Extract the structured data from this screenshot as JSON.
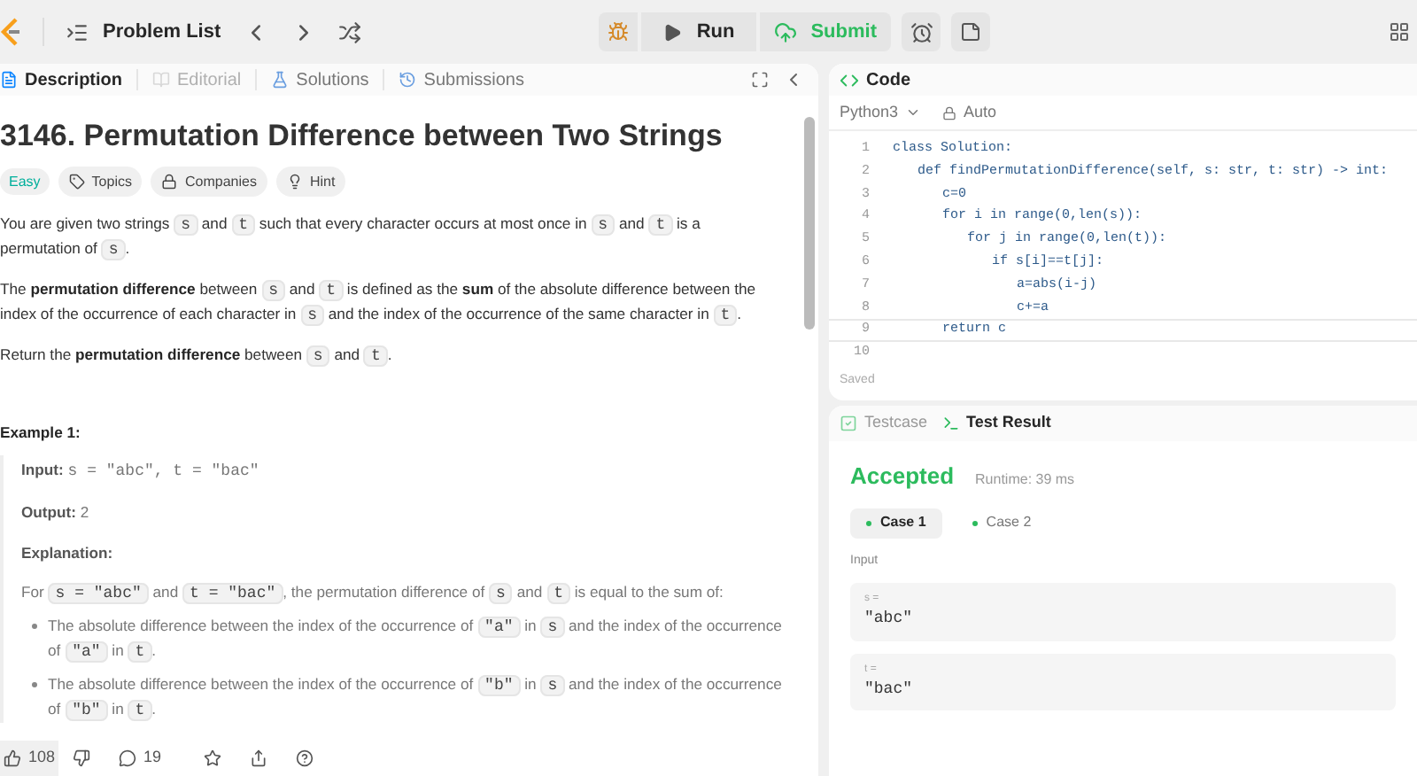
{
  "topbar": {
    "title": "Problem List",
    "run": "Run",
    "submit": "Submit"
  },
  "left_tabs": [
    {
      "label": "Description",
      "selected": true,
      "disabled": false,
      "kind": "description"
    },
    {
      "label": "Editorial",
      "selected": false,
      "disabled": true,
      "kind": "editorial"
    },
    {
      "label": "Solutions",
      "selected": false,
      "disabled": false,
      "kind": "solutions"
    },
    {
      "label": "Submissions",
      "selected": false,
      "disabled": false,
      "kind": "submissions"
    }
  ],
  "problem": {
    "title": "3146. Permutation Difference between Two Strings",
    "difficulty": "Easy",
    "tags": [
      {
        "label": "Topics",
        "kind": "tag"
      },
      {
        "label": "Companies",
        "kind": "lock"
      },
      {
        "label": "Hint",
        "kind": "bulb"
      }
    ],
    "paragraphs": [
      [
        {
          "kind": "text",
          "text": "You are given two strings "
        },
        {
          "kind": "code",
          "text": "s"
        },
        {
          "kind": "text",
          "text": " and "
        },
        {
          "kind": "code",
          "text": "t"
        },
        {
          "kind": "text",
          "text": " such that every character occurs at most once in "
        },
        {
          "kind": "code",
          "text": "s"
        },
        {
          "kind": "text",
          "text": " and "
        },
        {
          "kind": "code",
          "text": "t"
        },
        {
          "kind": "text",
          "text": " is a permutation of "
        },
        {
          "kind": "code",
          "text": "s"
        },
        {
          "kind": "text",
          "text": "."
        }
      ],
      [
        {
          "kind": "text",
          "text": "The "
        },
        {
          "kind": "bold",
          "text": "permutation difference"
        },
        {
          "kind": "text",
          "text": " between "
        },
        {
          "kind": "code",
          "text": "s"
        },
        {
          "kind": "text",
          "text": " and "
        },
        {
          "kind": "code",
          "text": "t"
        },
        {
          "kind": "text",
          "text": " is defined as the "
        },
        {
          "kind": "bold",
          "text": "sum"
        },
        {
          "kind": "text",
          "text": " of the absolute difference between the index of the occurrence of each character in "
        },
        {
          "kind": "code",
          "text": "s"
        },
        {
          "kind": "text",
          "text": " and the index of the occurrence of the same character in "
        },
        {
          "kind": "code",
          "text": "t"
        },
        {
          "kind": "text",
          "text": "."
        }
      ],
      [
        {
          "kind": "text",
          "text": "Return the "
        },
        {
          "kind": "bold",
          "text": "permutation difference"
        },
        {
          "kind": "text",
          "text": " between "
        },
        {
          "kind": "code",
          "text": "s"
        },
        {
          "kind": "text",
          "text": " and "
        },
        {
          "kind": "code",
          "text": "t"
        },
        {
          "kind": "text",
          "text": "."
        }
      ]
    ],
    "example": {
      "heading": "Example 1:",
      "input_label": "Input:",
      "input": "s = \"abc\", t = \"bac\"",
      "output_label": "Output:",
      "output": "2",
      "explanation_label": "Explanation:",
      "explanation": [
        {
          "kind": "text",
          "text": "For "
        },
        {
          "kind": "code",
          "text": "s = \"abc\""
        },
        {
          "kind": "text",
          "text": " and "
        },
        {
          "kind": "code",
          "text": "t = \"bac\""
        },
        {
          "kind": "text",
          "text": ", the permutation difference of "
        },
        {
          "kind": "code",
          "text": "s"
        },
        {
          "kind": "text",
          "text": " and "
        },
        {
          "kind": "code",
          "text": "t"
        },
        {
          "kind": "text",
          "text": " is equal to the sum of:"
        }
      ],
      "bullets": [
        [
          {
            "kind": "text",
            "text": "The absolute difference between the index of the occurrence of "
          },
          {
            "kind": "code",
            "text": "\"a\""
          },
          {
            "kind": "text",
            "text": " in "
          },
          {
            "kind": "code",
            "text": "s"
          },
          {
            "kind": "text",
            "text": " and the index of the occurrence of "
          },
          {
            "kind": "code",
            "text": "\"a\""
          },
          {
            "kind": "text",
            "text": " in "
          },
          {
            "kind": "code",
            "text": "t"
          },
          {
            "kind": "text",
            "text": "."
          }
        ],
        [
          {
            "kind": "text",
            "text": "The absolute difference between the index of the occurrence of "
          },
          {
            "kind": "code",
            "text": "\"b\""
          },
          {
            "kind": "text",
            "text": " in "
          },
          {
            "kind": "code",
            "text": "s"
          },
          {
            "kind": "text",
            "text": " and the index of the occurrence of "
          },
          {
            "kind": "code",
            "text": "\"b\""
          },
          {
            "kind": "text",
            "text": " in "
          },
          {
            "kind": "code",
            "text": "t"
          },
          {
            "kind": "text",
            "text": "."
          }
        ]
      ]
    }
  },
  "footer": {
    "likes": "108",
    "comments": "19"
  },
  "code_panel": {
    "title": "Code",
    "language": "Python3",
    "mode": "Auto",
    "status": "Saved",
    "lines": [
      {
        "number": "1",
        "text": "class Solution:",
        "children": [
          {
            "number": "2",
            "text": "def findPermutationDifference(self, s: str, t: str) -> int:",
            "children": [
              {
                "number": "3",
                "text": "c=0"
              },
              {
                "number": "4",
                "text": "for i in range(0,len(s)):",
                "children": [
                  {
                    "number": "5",
                    "text": "for j in range(0,len(t)):",
                    "children": [
                      {
                        "number": "6",
                        "text": "if s[i]==t[j]:",
                        "children": [
                          {
                            "number": "7",
                            "text": "a=abs(i-j)"
                          },
                          {
                            "number": "8",
                            "text": "c+=a"
                          }
                        ]
                      }
                    ]
                  }
                ]
              },
              {
                "number": "9",
                "text": "return c",
                "current": true
              }
            ]
          }
        ]
      },
      {
        "number": "10"
      }
    ]
  },
  "result_panel": {
    "tabs": [
      {
        "label": "Testcase",
        "selected": false,
        "kind": "check"
      },
      {
        "label": "Test Result",
        "selected": true,
        "kind": "terminal"
      }
    ],
    "verdict": "Accepted",
    "runtime": "Runtime: 39 ms",
    "cases": [
      {
        "label": "Case 1",
        "selected": true
      },
      {
        "label": "Case 2",
        "selected": false
      }
    ],
    "input_label": "Input",
    "inputs": [
      {
        "name": "s =",
        "value": "\"abc\""
      },
      {
        "name": "t =",
        "value": "\"bac\""
      }
    ]
  }
}
